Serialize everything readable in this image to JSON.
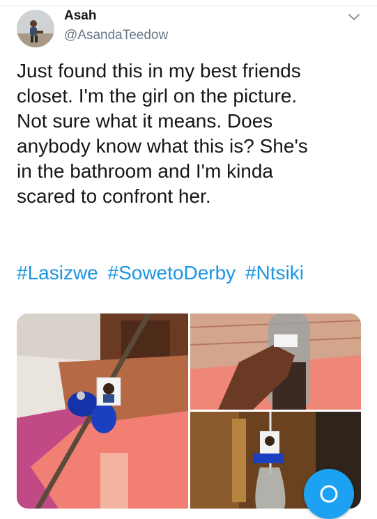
{
  "colors": {
    "text_primary": "#14171a",
    "text_secondary": "#657786",
    "link": "#1b95e0",
    "fab": "#1da1f2"
  },
  "tweet": {
    "author": {
      "name": "Asah",
      "handle": "@AsandaTeedow",
      "avatar_icon": "profile-photo"
    },
    "menu_icon": "chevron-down-icon",
    "text": "Just found this in my best friends\ncloset. I'm the girl on the picture.\nNot sure what it means. Does\nanybody know what this is? She's\nin the bathroom and I'm kinda\nscared to confront her.",
    "hashtags": [
      "#Lasizwe",
      "#SowetoDerby",
      "#Ntsiki"
    ],
    "media": [
      {
        "icon": "photo-stick-with-blue-ribbon"
      },
      {
        "icon": "photo-hand-holding-bottle"
      },
      {
        "icon": "photo-bottle-with-picture"
      }
    ]
  },
  "fab": {
    "icon": "compose-icon"
  }
}
